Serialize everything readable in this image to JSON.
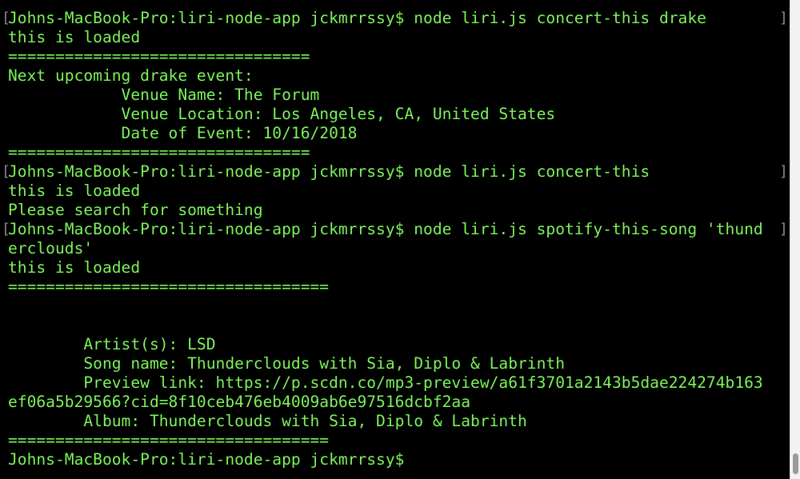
{
  "terminal": {
    "lines": [
      {
        "text": "Johns-MacBook-Pro:liri-node-app jckmrrssy$ node liri.js concert-this drake",
        "prompt": true
      },
      {
        "text": "this is loaded"
      },
      {
        "text": "================================"
      },
      {
        "text": "Next upcoming drake event:"
      },
      {
        "text": "            Venue Name: The Forum"
      },
      {
        "text": "            Venue Location: Los Angeles, CA, United States"
      },
      {
        "text": "            Date of Event: 10/16/2018"
      },
      {
        "text": "================================"
      },
      {
        "text": "Johns-MacBook-Pro:liri-node-app jckmrrssy$ node liri.js concert-this",
        "prompt": true
      },
      {
        "text": "this is loaded"
      },
      {
        "text": "Please search for something"
      },
      {
        "text": "Johns-MacBook-Pro:liri-node-app jckmrrssy$ node liri.js spotify-this-song 'thund",
        "prompt": true
      },
      {
        "text": "erclouds'"
      },
      {
        "text": "this is loaded"
      },
      {
        "text": "=================================="
      },
      {
        "text": ""
      },
      {
        "text": ""
      },
      {
        "text": "        Artist(s): LSD"
      },
      {
        "text": "        Song name: Thunderclouds with Sia, Diplo & Labrinth"
      },
      {
        "text": "        Preview link: https://p.scdn.co/mp3-preview/a61f3701a2143b5dae224274b163"
      },
      {
        "text": "ef06a5b29566?cid=8f10ceb476eb4009ab6e97516dcbf2aa"
      },
      {
        "text": "        Album: Thunderclouds with Sia, Diplo & Labrinth"
      },
      {
        "text": "=================================="
      },
      {
        "text": "Johns-MacBook-Pro:liri-node-app jckmrrssy$"
      }
    ]
  },
  "colors": {
    "background": "#000000",
    "text": "#7CF35A",
    "bracket": "#8a8a8a"
  }
}
